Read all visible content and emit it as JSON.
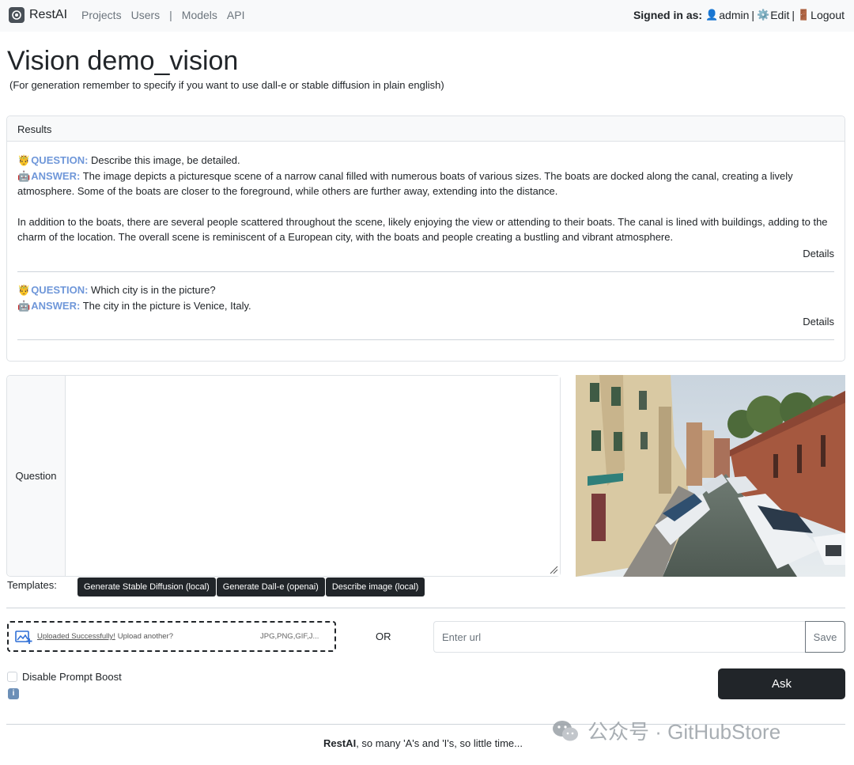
{
  "navbar": {
    "brand": "RestAI",
    "links": [
      "Projects",
      "Users",
      "|",
      "Models",
      "API"
    ],
    "signed_in_label": "Signed in as:",
    "user": "admin",
    "edit": "Edit",
    "logout": "Logout"
  },
  "page": {
    "title": "Vision demo_vision",
    "subtitle": "(For generation remember to specify if you want to use dall-e or stable diffusion in plain english)"
  },
  "results": {
    "header": "Results",
    "question_label": "QUESTION:",
    "answer_label": "ANSWER:",
    "details_label": "Details",
    "items": [
      {
        "question": "Describe this image, be detailed.",
        "answer_p1": "The image depicts a picturesque scene of a narrow canal filled with numerous boats of various sizes. The boats are docked along the canal, creating a lively atmosphere. Some of the boats are closer to the foreground, while others are further away, extending into the distance.",
        "answer_p2": "In addition to the boats, there are several people scattered throughout the scene, likely enjoying the view or attending to their boats. The canal is lined with buildings, adding to the charm of the location. The overall scene is reminiscent of a European city, with the boats and people creating a bustling and vibrant atmosphere."
      },
      {
        "question": "Which city is in the picture?",
        "answer_p1": "The city in the picture is Venice, Italy."
      }
    ]
  },
  "form": {
    "question_label": "Question",
    "question_value": "",
    "templates_label": "Templates:",
    "templates": [
      "Generate Stable Diffusion (local)",
      "Generate Dall-e (openai)",
      "Describe image (local)"
    ],
    "upload_success": "Uploaded Successfully!",
    "upload_another": "Upload another?",
    "upload_types": "JPG,PNG,GIF,J...",
    "or_label": "OR",
    "url_placeholder": "Enter url",
    "save_label": "Save",
    "disable_boost_label": "Disable Prompt Boost",
    "ask_label": "Ask"
  },
  "footer": {
    "brand": "RestAI",
    "tagline": ", so many 'A's and 'I's, so little time..."
  },
  "watermark": {
    "text": "公众号 · GitHubStore"
  },
  "colors": {
    "label_blue": "#6f97d9",
    "dark_button": "#212529",
    "navbar_bg": "#f8f9fa"
  }
}
